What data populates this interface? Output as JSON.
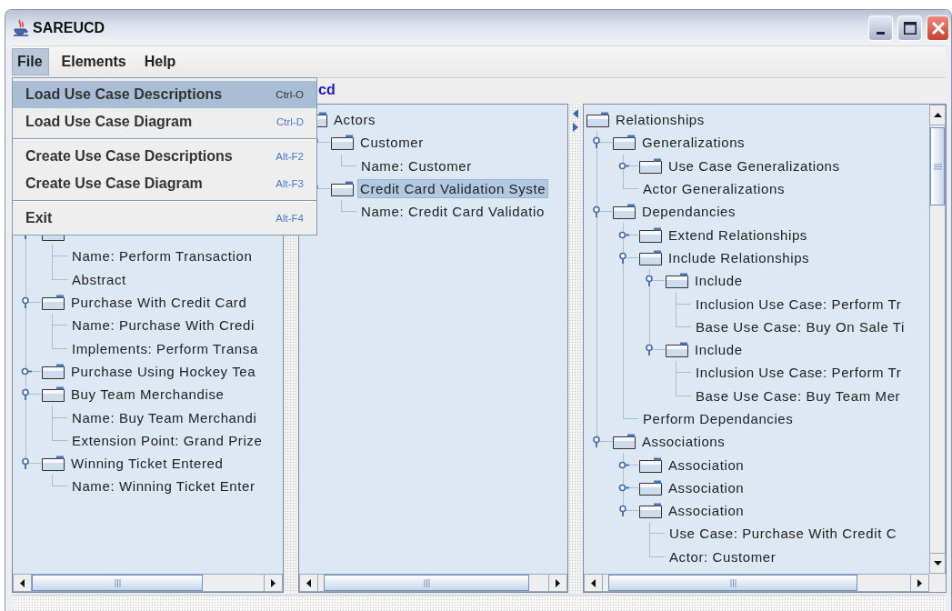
{
  "window": {
    "title": "SAREUCD"
  },
  "menu_bar": [
    {
      "label": "File",
      "selected": true
    },
    {
      "label": "Elements",
      "selected": false
    },
    {
      "label": "Help",
      "selected": false
    }
  ],
  "file_menu": {
    "items": [
      {
        "kind": "item",
        "label": "Load Use Case Descriptions",
        "shortcut": "Ctrl-O",
        "selected": true
      },
      {
        "kind": "item",
        "label": "Load Use Case Diagram",
        "shortcut": "Ctrl-D",
        "selected": false
      },
      {
        "kind": "separator"
      },
      {
        "kind": "item",
        "label": "Create Use Case Descriptions",
        "shortcut": "Alt-F2",
        "selected": false
      },
      {
        "kind": "item",
        "label": "Create Use Case Diagram",
        "shortcut": "Alt-F3",
        "selected": false
      },
      {
        "kind": "separator"
      },
      {
        "kind": "item",
        "label": "Exit",
        "shortcut": "Alt-F4",
        "selected": false
      }
    ]
  },
  "toolbar": {
    "label": "cd"
  },
  "panes": [
    {
      "tree": [
        {
          "kind": "folder",
          "expanded": true,
          "children": [
            {
              "label": "Name: Perform Transaction",
              "kind": "leaf",
              "selected": false
            },
            {
              "label": "Abstract",
              "kind": "leaf",
              "selected": false
            }
          ]
        },
        {
          "label": "Purchase With Credit Card",
          "kind": "folder",
          "expanded": true,
          "selected": false,
          "children": [
            {
              "label": "Name: Purchase With Credi",
              "kind": "leaf",
              "selected": false
            },
            {
              "label": "Implements: Perform Transa",
              "kind": "leaf",
              "selected": false
            }
          ]
        },
        {
          "label": "Purchase Using Hockey Tea",
          "kind": "folder",
          "expanded": false,
          "selected": false
        },
        {
          "label": "Buy Team Merchandise",
          "kind": "folder",
          "expanded": true,
          "selected": false,
          "children": [
            {
              "label": "Name: Buy Team Merchandi",
              "kind": "leaf",
              "selected": false
            },
            {
              "label": "Extension Point: Grand Prize",
              "kind": "leaf",
              "selected": false
            }
          ]
        },
        {
          "label": "Winning Ticket Entered",
          "kind": "folder",
          "expanded": true,
          "selected": false,
          "children": [
            {
              "label": "Name: Winning Ticket Enter",
              "kind": "leaf",
              "selected": false
            }
          ]
        }
      ]
    },
    {
      "tree": [
        {
          "label": "Actors",
          "kind": "folder",
          "selected": false,
          "children": [
            {
              "label": "Customer",
              "kind": "folder",
              "expanded": true,
              "selected": false,
              "children": [
                {
                  "label": "Name: Customer",
                  "kind": "leaf",
                  "selected": false
                }
              ]
            },
            {
              "label": "Credit Card Validation Syste",
              "kind": "folder",
              "expanded": true,
              "selected": true,
              "children": [
                {
                  "label": "Name: Credit Card Validatio",
                  "kind": "leaf",
                  "selected": false
                }
              ]
            }
          ]
        }
      ]
    },
    {
      "tree": [
        {
          "label": "Relationships",
          "kind": "folder",
          "selected": false,
          "children": [
            {
              "label": "Generalizations",
              "kind": "folder",
              "expanded": true,
              "selected": false,
              "children": [
                {
                  "label": "Use Case Generalizations",
                  "kind": "folder",
                  "expanded": false,
                  "selected": false
                },
                {
                  "label": "Actor Generalizations",
                  "kind": "leaf",
                  "selected": false
                }
              ]
            },
            {
              "label": "Dependancies",
              "kind": "folder",
              "expanded": true,
              "selected": false,
              "children": [
                {
                  "label": "Extend Relationships",
                  "kind": "folder",
                  "expanded": false,
                  "selected": false
                },
                {
                  "label": "Include Relationships",
                  "kind": "folder",
                  "expanded": true,
                  "selected": false,
                  "children": [
                    {
                      "label": "Include",
                      "kind": "folder",
                      "expanded": true,
                      "selected": false,
                      "children": [
                        {
                          "label": "Inclusion Use Case: Perform Tr",
                          "kind": "leaf",
                          "selected": false
                        },
                        {
                          "label": "Base Use Case: Buy On Sale Ti",
                          "kind": "leaf",
                          "selected": false
                        }
                      ]
                    },
                    {
                      "label": "Include",
                      "kind": "folder",
                      "expanded": true,
                      "selected": false,
                      "children": [
                        {
                          "label": "Inclusion Use Case: Perform Tr",
                          "kind": "leaf",
                          "selected": false
                        },
                        {
                          "label": "Base Use Case: Buy Team Mer",
                          "kind": "leaf",
                          "selected": false
                        }
                      ]
                    }
                  ]
                },
                {
                  "label": "Perform Dependancies",
                  "kind": "leaf",
                  "selected": false
                }
              ]
            },
            {
              "label": "Associations",
              "kind": "folder",
              "expanded": true,
              "selected": false,
              "children": [
                {
                  "label": "Association",
                  "kind": "folder",
                  "expanded": false,
                  "selected": false
                },
                {
                  "label": "Association",
                  "kind": "folder",
                  "expanded": false,
                  "selected": false
                },
                {
                  "label": "Association",
                  "kind": "folder",
                  "expanded": true,
                  "selected": false,
                  "children": [
                    {
                      "label": "Use Case: Purchase With Credit C",
                      "kind": "leaf",
                      "selected": false
                    },
                    {
                      "label": "Actor: Customer",
                      "kind": "leaf",
                      "selected": false
                    }
                  ]
                }
              ]
            }
          ]
        }
      ]
    }
  ]
}
